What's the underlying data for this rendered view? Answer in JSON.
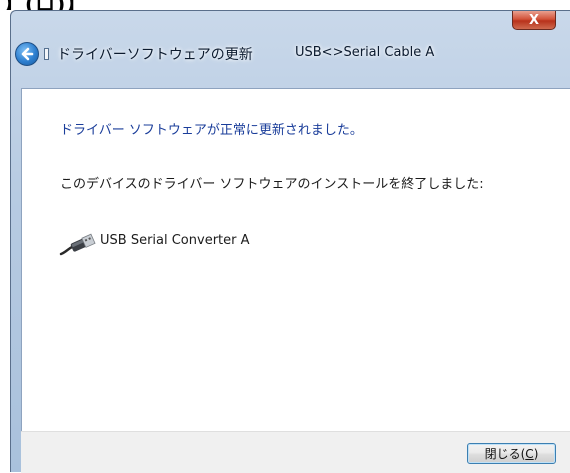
{
  "page_heading_fragment": "】(ロ)】",
  "window": {
    "close_glyph": "X",
    "title": "ドライバーソフトウェアの更新",
    "device": "USB<>Serial Cable  A"
  },
  "content": {
    "success_message": "ドライバー ソフトウェアが正常に更新されました。",
    "install_message": "このデバイスのドライバー ソフトウェアのインストールを終了しました:",
    "device_name": "USB Serial Converter A",
    "device_icon": "usb-plug-icon"
  },
  "footer": {
    "close_label": "閉じる(",
    "close_mnemonic": "C",
    "close_suffix": ")"
  },
  "colors": {
    "success_text": "#1a3d9a",
    "button_border": "#3c7fb1",
    "close_button_red": "#c8402a"
  }
}
